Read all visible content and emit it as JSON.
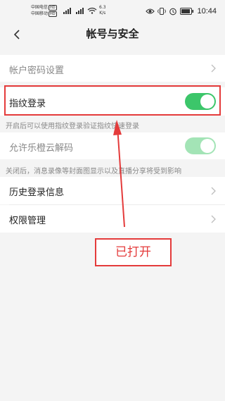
{
  "status_bar": {
    "carrier_1": "中国电信",
    "carrier_2": "中国移动",
    "hd": "HD",
    "net_speed_value": "6.3",
    "net_speed_unit": "K/s",
    "time": "10:44",
    "icons": [
      "eye-icon",
      "vibrate-icon",
      "alarm-icon",
      "battery-icon"
    ]
  },
  "nav": {
    "title": "帐号与安全",
    "back_icon": "chevron-left-icon"
  },
  "settings": {
    "password_setting": "帐户密码设置",
    "fingerprint_login": "指纹登录",
    "fingerprint_enabled": true,
    "fingerprint_hint": "开启后可以使用指纹登录验证指纹快速登录",
    "cloud_decode": "允许乐橙云解码",
    "cloud_decode_enabled": true,
    "cloud_decode_hint": "关闭后，消息录像等封面图显示以及直播分享将受到影响",
    "login_history": "历史登录信息",
    "permission_manage": "权限管理"
  },
  "annotation": {
    "label": "已打开",
    "color": "#e43b3b"
  },
  "colors": {
    "toggle_on": "#3cc66a",
    "toggle_on_dim": "#a3e4b6",
    "background": "#f4f4f4"
  }
}
